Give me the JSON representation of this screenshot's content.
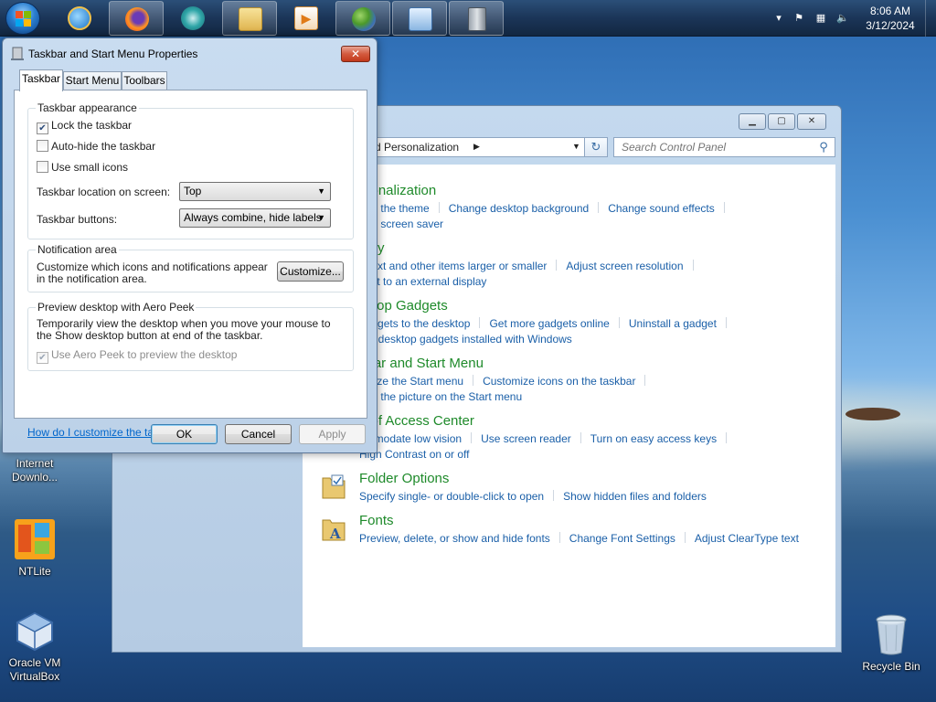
{
  "taskbar": {
    "clock_time": "8:06 AM",
    "clock_date": "3/12/2024",
    "apps": [
      {
        "name": "internet-explorer-icon",
        "running": false
      },
      {
        "name": "firefox-icon",
        "running": true
      },
      {
        "name": "app-icon",
        "running": false
      },
      {
        "name": "file-explorer-icon",
        "running": true
      },
      {
        "name": "media-player-icon",
        "running": false
      },
      {
        "name": "users-icon",
        "running": true
      },
      {
        "name": "control-panel-icon",
        "running": true
      },
      {
        "name": "server-icon",
        "running": true
      }
    ]
  },
  "desktop": {
    "icons": [
      {
        "label": "Internet Downlo...",
        "icon": "internet-download-icon"
      },
      {
        "label": "NTLite",
        "icon": "ntlite-icon"
      },
      {
        "label": "Oracle VM VirtualBox",
        "icon": "virtualbox-icon"
      },
      {
        "label": "Recycle Bin",
        "icon": "recycle-bin-icon"
      }
    ]
  },
  "control_panel": {
    "address_text": "d Personalization",
    "search_placeholder": "Search Control Panel",
    "categories": [
      {
        "title": "rsonalization",
        "links": [
          "nge the theme",
          "Change desktop background",
          "Change sound effects"
        ],
        "links2": [
          "nge screen saver"
        ]
      },
      {
        "title": "play",
        "links": [
          "e text and other items larger or smaller",
          "Adjust screen resolution"
        ],
        "links2": [
          "nect to an external display"
        ]
      },
      {
        "title": "sktop Gadgets",
        "links": [
          "gadgets to the desktop",
          "Get more gadgets online",
          "Uninstall a gadget"
        ],
        "links2": [
          "ore desktop gadgets installed with Windows"
        ]
      },
      {
        "title": "kbar and Start Menu",
        "links": [
          "omize the Start menu",
          "Customize icons on the taskbar"
        ],
        "links2": [
          "nge the picture on the Start menu"
        ]
      },
      {
        "title": "e of Access Center",
        "links": [
          "ommodate low vision",
          "Use screen reader",
          "Turn on easy access keys"
        ],
        "links2": [
          "High Contrast on or off"
        ]
      },
      {
        "title": "Folder Options",
        "links": [
          "Specify single- or double-click to open",
          "Show hidden files and folders"
        ],
        "links2": []
      },
      {
        "title": "Fonts",
        "links": [
          "Preview, delete, or show and hide fonts",
          "Change Font Settings",
          "Adjust ClearType text"
        ],
        "links2": []
      }
    ]
  },
  "dialog": {
    "title": "Taskbar and Start Menu Properties",
    "tabs": [
      "Taskbar",
      "Start Menu",
      "Toolbars"
    ],
    "appearance": {
      "group_label": "Taskbar appearance",
      "lock_label": "Lock the taskbar",
      "lock_checked": true,
      "autohide_label": "Auto-hide the taskbar",
      "autohide_checked": false,
      "small_icons_label": "Use small icons",
      "small_icons_checked": false,
      "location_label": "Taskbar location on screen:",
      "location_value": "Top",
      "buttons_label": "Taskbar buttons:",
      "buttons_value": "Always combine, hide labels"
    },
    "notification": {
      "group_label": "Notification area",
      "text": "Customize which icons and notifications appear in the notification area.",
      "customize_label": "Customize..."
    },
    "peek": {
      "group_label": "Preview desktop with Aero Peek",
      "text": "Temporarily view the desktop when you move your mouse to the Show desktop button at end of the taskbar.",
      "checkbox_label": "Use Aero Peek to preview the desktop",
      "checked": true,
      "disabled": true
    },
    "help_link": "How do I customize the taskbar?",
    "ok_label": "OK",
    "cancel_label": "Cancel",
    "apply_label": "Apply"
  }
}
